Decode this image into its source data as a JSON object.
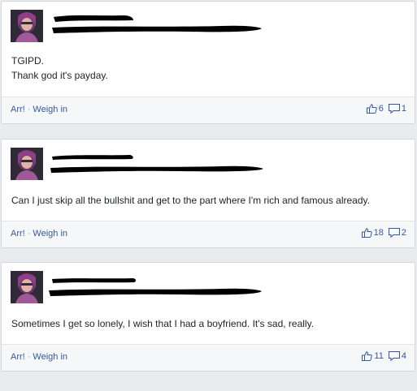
{
  "posts": [
    {
      "text": "TGIPD.\nThank god it's payday.",
      "actions": {
        "arr": "Arr!",
        "separator": "·",
        "weigh_in": "Weigh in"
      },
      "likes": "6",
      "comments": "1"
    },
    {
      "text": "Can I just skip all the bullshit and get to the part where I'm rich and famous already.",
      "actions": {
        "arr": "Arr!",
        "separator": "·",
        "weigh_in": "Weigh in"
      },
      "likes": "18",
      "comments": "2"
    },
    {
      "text": "Sometimes I get so lonely, I wish that I had a boyfriend. It's sad, really.",
      "actions": {
        "arr": "Arr!",
        "separator": "·",
        "weigh_in": "Weigh in"
      },
      "likes": "11",
      "comments": "4"
    }
  ],
  "colors": {
    "background": "#e9ebee",
    "link": "#365899",
    "text": "#1d2129",
    "redaction": "#000000"
  },
  "icons": {
    "like": "thumbs-up-icon",
    "comment": "comment-bubble-icon"
  }
}
